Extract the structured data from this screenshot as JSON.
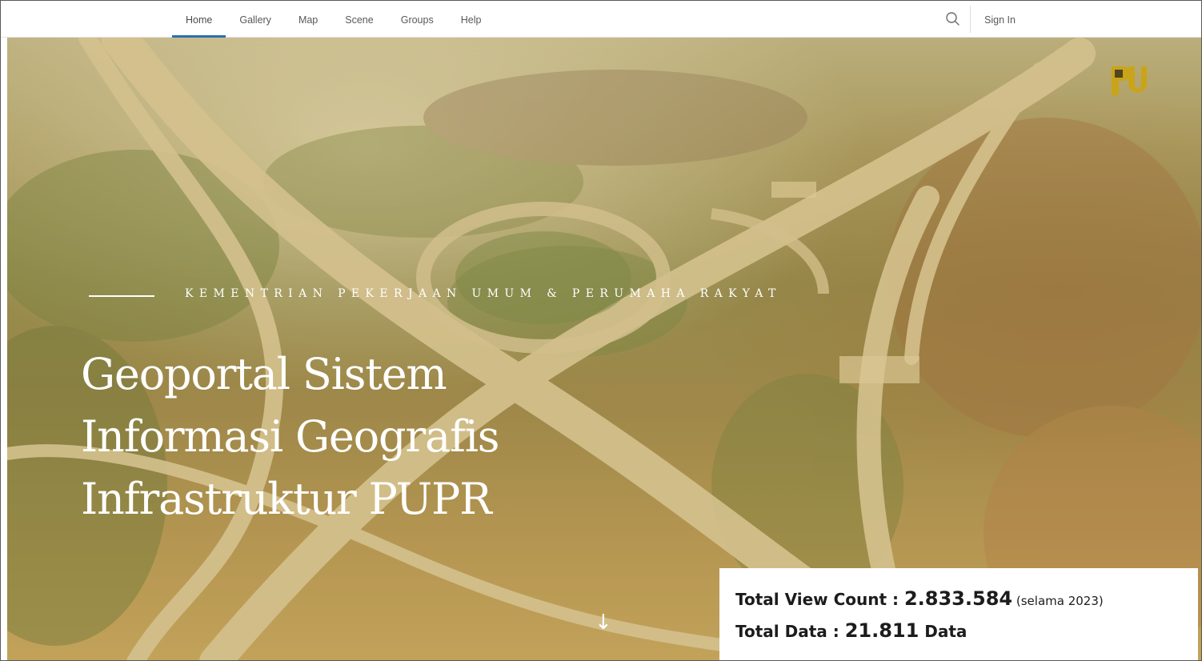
{
  "nav": {
    "items": [
      {
        "label": "Home",
        "active": true
      },
      {
        "label": "Gallery",
        "active": false
      },
      {
        "label": "Map",
        "active": false
      },
      {
        "label": "Scene",
        "active": false
      },
      {
        "label": "Groups",
        "active": false
      },
      {
        "label": "Help",
        "active": false
      }
    ],
    "search_icon": "search-icon",
    "signin_label": "Sign In",
    "accent": "#2d6fb0"
  },
  "hero": {
    "kicker": "KEMENTRIAN PEKERJAAN UMUM  & PERUMAHA RAKYAT",
    "title_lines": [
      "Geoportal Sistem",
      "Informasi Geografis",
      "Infrastruktur PUPR"
    ],
    "logo_icon": "pupr-logo-icon",
    "scroll_icon": "arrow-down-icon",
    "scroll_glyph": "↓"
  },
  "stats": {
    "view_label": "Total View Count : ",
    "view_value": "2.833.584",
    "view_note": " (selama 2023)",
    "data_label": "Total Data : ",
    "data_value": "21.811",
    "data_unit": " Data"
  }
}
